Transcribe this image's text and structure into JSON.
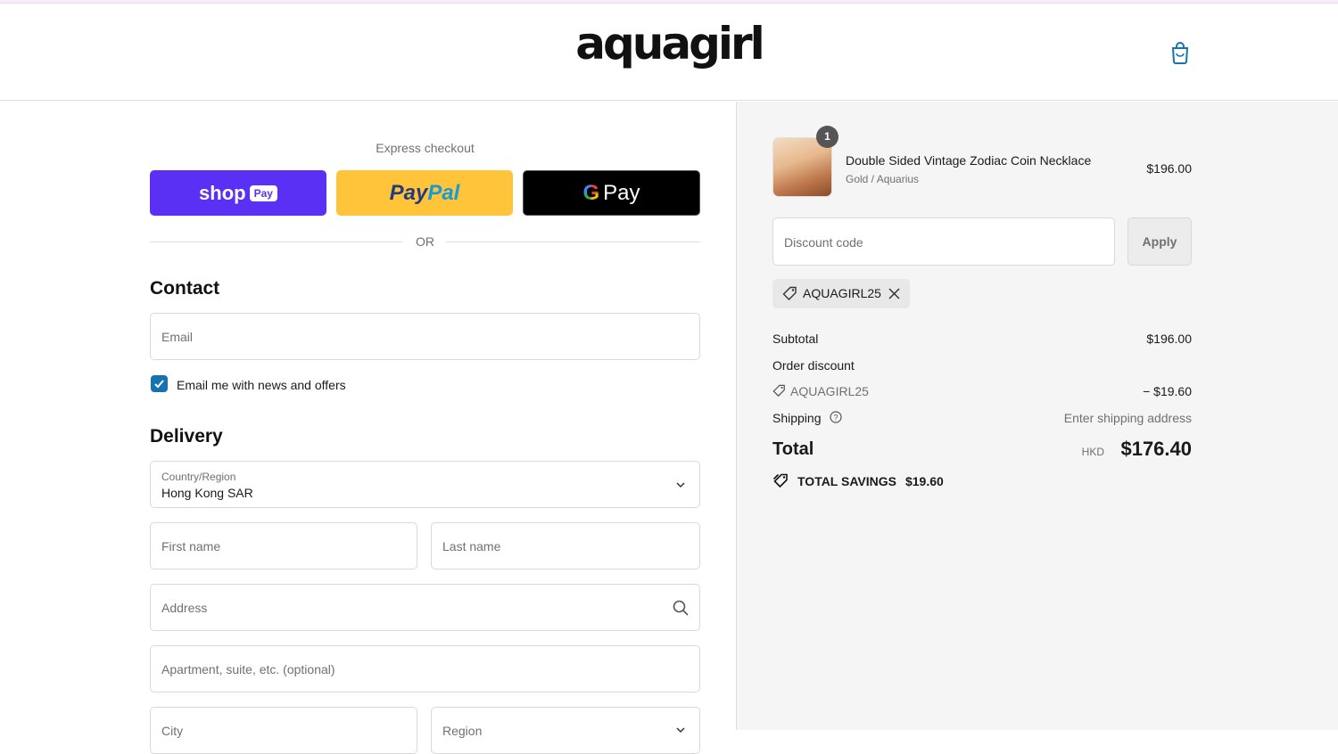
{
  "header": {
    "logo": "aquagirl",
    "cart_icon": "shopping-bag-icon"
  },
  "express": {
    "label": "Express checkout",
    "shop_pay": {
      "text": "shop",
      "pill": "Pay",
      "color": "#5a31f4"
    },
    "paypal": {
      "part1": "Pay",
      "part2": "Pal",
      "color": "#ffc439"
    },
    "gpay": {
      "g": "G",
      "text": "Pay",
      "color": "#000000"
    },
    "divider": "OR"
  },
  "contact": {
    "heading": "Contact",
    "email_placeholder": "Email",
    "newsletter_label": "Email me with news and offers",
    "newsletter_checked": true
  },
  "delivery": {
    "heading": "Delivery",
    "country_label": "Country/Region",
    "country_value": "Hong Kong SAR",
    "first_name_placeholder": "First name",
    "last_name_placeholder": "Last name",
    "address_placeholder": "Address",
    "apartment_placeholder": "Apartment, suite, etc. (optional)",
    "city_placeholder": "City",
    "region_placeholder": "Region"
  },
  "summary": {
    "item": {
      "quantity": "1",
      "name": "Double Sided Vintage Zodiac Coin Necklace",
      "variant": "Gold / Aquarius",
      "price": "$196.00"
    },
    "discount_placeholder": "Discount code",
    "apply_label": "Apply",
    "applied_code": "AQUAGIRL25",
    "subtotal_label": "Subtotal",
    "subtotal_value": "$196.00",
    "order_discount_label": "Order discount",
    "discount_code": "AQUAGIRL25",
    "discount_value": "− $19.60",
    "shipping_label": "Shipping",
    "shipping_value": "Enter shipping address",
    "total_label": "Total",
    "currency": "HKD",
    "total_value": "$176.40",
    "savings_label": "TOTAL SAVINGS",
    "savings_value": "$19.60"
  },
  "colors": {
    "accent": "#1773b0",
    "summary_bg": "#f5f5f5"
  }
}
